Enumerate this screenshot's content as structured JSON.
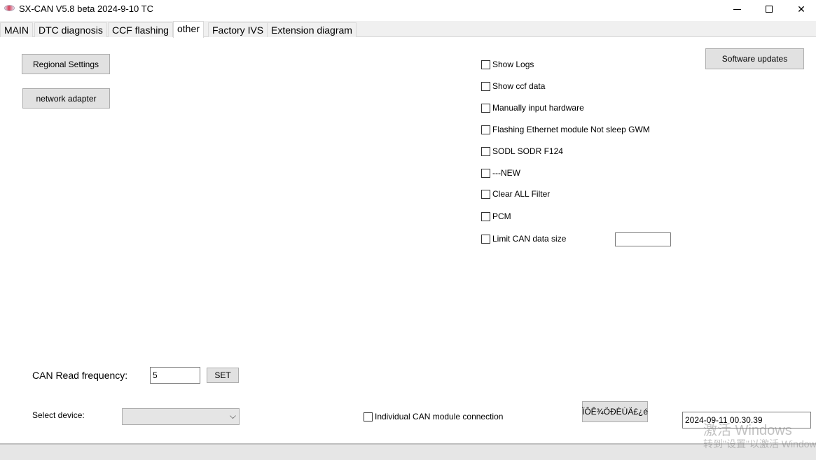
{
  "window": {
    "title": "SX-CAN V5.8 beta 2024-9-10 TC",
    "icon": "app-logo-icon",
    "controls": {
      "minimize": "minimize-icon",
      "maximize": "maximize-icon",
      "close": "close-icon",
      "close_glyph": "✕"
    }
  },
  "tabs": [
    {
      "label": "MAIN",
      "active": false
    },
    {
      "label": "DTC diagnosis",
      "active": false
    },
    {
      "label": "CCF flashing",
      "active": false
    },
    {
      "label": "other",
      "active": true
    },
    {
      "label": "Factory IVS",
      "active": false
    },
    {
      "label": "Extension diagram",
      "active": false
    }
  ],
  "left_buttons": {
    "regional_settings": "Regional Settings",
    "network_adapter": "network adapter"
  },
  "software_updates": "Software updates",
  "options": [
    {
      "label": "Show Logs",
      "checked": false
    },
    {
      "label": "Show ccf data",
      "checked": false
    },
    {
      "label": "Manually input hardware",
      "checked": false
    },
    {
      "label": "Flashing Ethernet module Not sleep GWM",
      "checked": false
    },
    {
      "label": "SODL SODR F124",
      "checked": false
    },
    {
      "label": "---NEW",
      "checked": false
    },
    {
      "label": "Clear ALL Filter",
      "checked": false
    },
    {
      "label": "PCM",
      "checked": false
    },
    {
      "label": "Limit CAN data size",
      "checked": false
    }
  ],
  "limit_can_data_size_value": "",
  "can_read_frequency": {
    "label": "CAN Read frequency:",
    "value": "5",
    "set_label": "SET"
  },
  "select_device": {
    "label": "Select device:",
    "value": "",
    "chevron": "⌵"
  },
  "individual_can_module": {
    "label": "Individual CAN module connection",
    "checked": false
  },
  "garbled_button": "ÏÔÊ¾ÖÐÈÙÄ£¿é",
  "timestamp": "2024-09-11  00.30.39",
  "watermark": {
    "line1": "激活 Windows",
    "line2": "转到\"设置\"以激活 Windows。"
  }
}
